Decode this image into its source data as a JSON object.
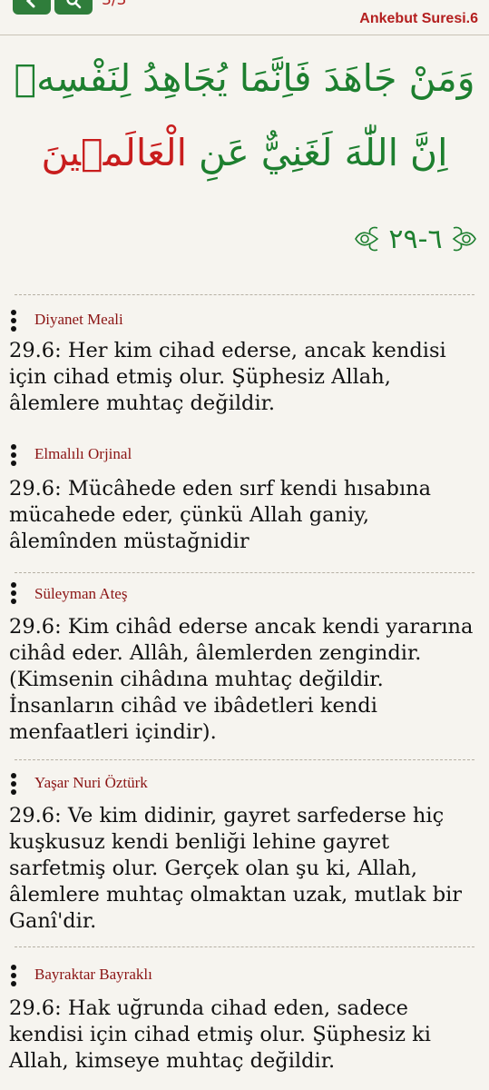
{
  "header": {
    "page_count": "3/3",
    "surah_title": "Ankebut Suresi.6",
    "colors": {
      "bar_green": "#2f7d3b",
      "title_red": "#b41f1f"
    },
    "buttons": [
      {
        "icon": "chevron-left-icon"
      },
      {
        "icon": "search-icon"
      }
    ]
  },
  "ayah": {
    "arabic_line1": "وَمَنْ جَاهَدَ فَاِنَّمَا يُجَاهِدُ لِنَفْسِه۪",
    "arabic_line2_green": "اِنَّ اللّٰهَ لَغَنِيٌّ عَنِ ",
    "arabic_line2_red": "الْعَالَم۪ينَ",
    "number": "٦-٢٩",
    "colors": {
      "green": "#1d7f2f",
      "red": "#c81d1d"
    }
  },
  "translations": [
    {
      "name": "Diyanet Meali",
      "text": "29.6: Her kim cihad ederse, ancak kendisi için cihad etmiş olur. Şüphesiz Allah, âlemlere muhtaç değildir."
    },
    {
      "name": "Elmalılı Orjinal",
      "text": "29.6: Mücâhede eden sırf kendi hısabına mücahede eder, çünkü Allah ganiy, âlemînden müstağnidir"
    },
    {
      "name": "Süleyman Ateş",
      "text": "29.6: Kim cihâd ederse ancak kendi yararına cihâd eder. Allâh, âlemlerden zengindir. (Kimsenin cihâdına muhtaç değildir. İnsanların cihâd ve ibâdetleri kendi menfaatleri içindir)."
    },
    {
      "name": "Yaşar Nuri Öztürk",
      "text": "29.6: Ve kim didinir, gayret sarfederse hiç kuşkusuz kendi benliği lehine gayret sarfetmiş olur. Gerçek olan şu ki, Allah, âlemlere muhtaç olmaktan uzak, mutlak bir Ganî'dir."
    },
    {
      "name": "Bayraktar Bayraklı",
      "text": "29.6: Hak uğrunda cihad eden, sadece kendisi için cihad etmiş olur. Şüphesiz ki Allah, kimseye muhtaç değildir."
    }
  ]
}
